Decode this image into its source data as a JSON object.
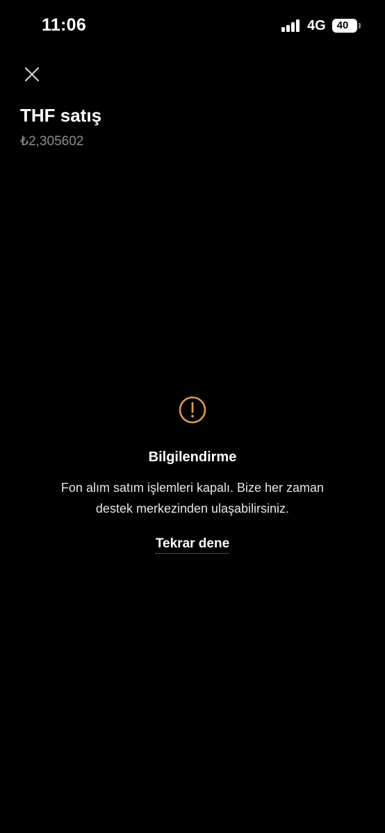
{
  "status_bar": {
    "time": "11:06",
    "network": "4G",
    "battery": "40",
    "icons": [
      "signal-icon",
      "battery-icon"
    ]
  },
  "header": {
    "close_icon": "close-icon",
    "title": "THF satış",
    "price": "₺2,305602"
  },
  "info": {
    "icon": "warning-icon",
    "icon_color": "#E09A43",
    "title": "Bilgilendirme",
    "message": "Fon alım satım işlemleri kapalı. Bize her zaman destek merkezinden ulaşabilirsiniz.",
    "retry_label": "Tekrar dene"
  }
}
